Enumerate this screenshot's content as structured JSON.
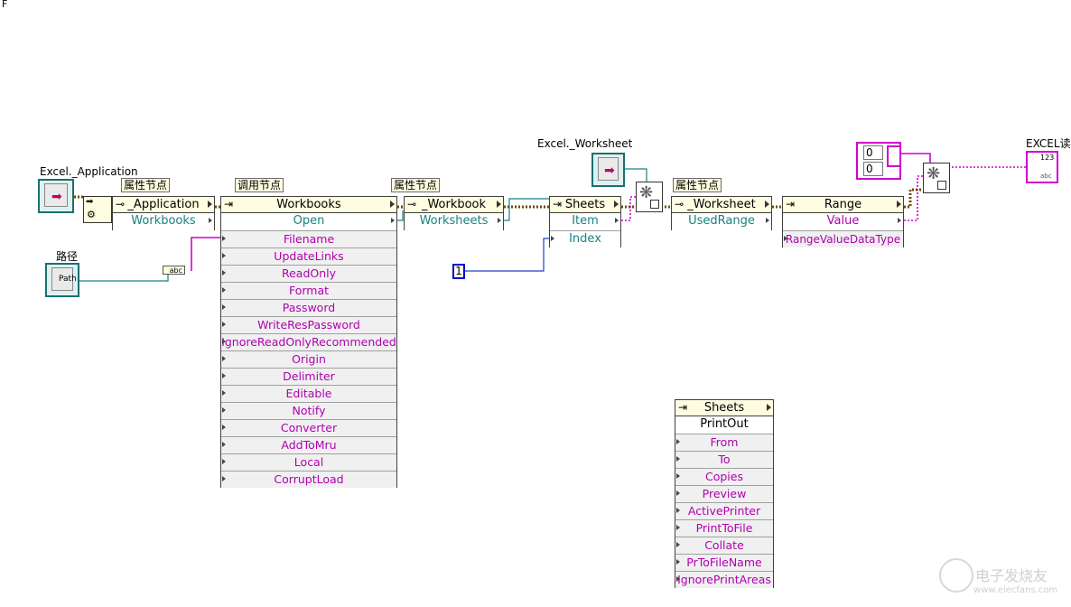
{
  "labels": {
    "corner_mark": "F",
    "excel_application": "Excel._Application",
    "excel_worksheet": "Excel._Worksheet",
    "path_label": "路径",
    "excel_read": "EXCEL读",
    "tag_prop1": "属性节点",
    "tag_invoke": "调用节点",
    "tag_prop2": "属性节点",
    "tag_prop3": "属性节点"
  },
  "nodes": {
    "application": {
      "class": "_Application",
      "rows": [
        "Workbooks"
      ]
    },
    "workbooks": {
      "class": "Workbooks",
      "method": "Open",
      "params": [
        "Filename",
        "UpdateLinks",
        "ReadOnly",
        "Format",
        "Password",
        "WriteResPassword",
        "IgnoreReadOnlyRecommended",
        "Origin",
        "Delimiter",
        "Editable",
        "Notify",
        "Converter",
        "AddToMru",
        "Local",
        "CorruptLoad"
      ]
    },
    "workbook": {
      "class": "_Workbook",
      "rows": [
        "Worksheets"
      ]
    },
    "sheets": {
      "class": "Sheets",
      "rows": [
        "Item",
        "Index"
      ]
    },
    "worksheet": {
      "class": "_Worksheet",
      "rows": [
        "UsedRange"
      ]
    },
    "range": {
      "class": "Range",
      "rows": [
        "Value",
        "RangeValueDataType"
      ]
    },
    "printout": {
      "class": "Sheets",
      "method": "PrintOut",
      "params": [
        "From",
        "To",
        "Copies",
        "Preview",
        "ActivePrinter",
        "PrintToFile",
        "Collate",
        "PrToFileName",
        "IgnorePrintAreas"
      ]
    }
  },
  "constants": {
    "index_value": "1",
    "array_values": [
      "0",
      "0"
    ],
    "path_icon_text": "Path",
    "path_conv_text": "abc",
    "indicator_text": "123",
    "indicator_sub": "abc"
  },
  "watermark": {
    "text": "电子发烧友",
    "url": "www.elecfans.com"
  },
  "colors": {
    "teal_wire": "#1a8080",
    "pink_wire": "#d000d0",
    "refnum_wire": "#7a4a00",
    "blue_const": "#0000cc"
  }
}
